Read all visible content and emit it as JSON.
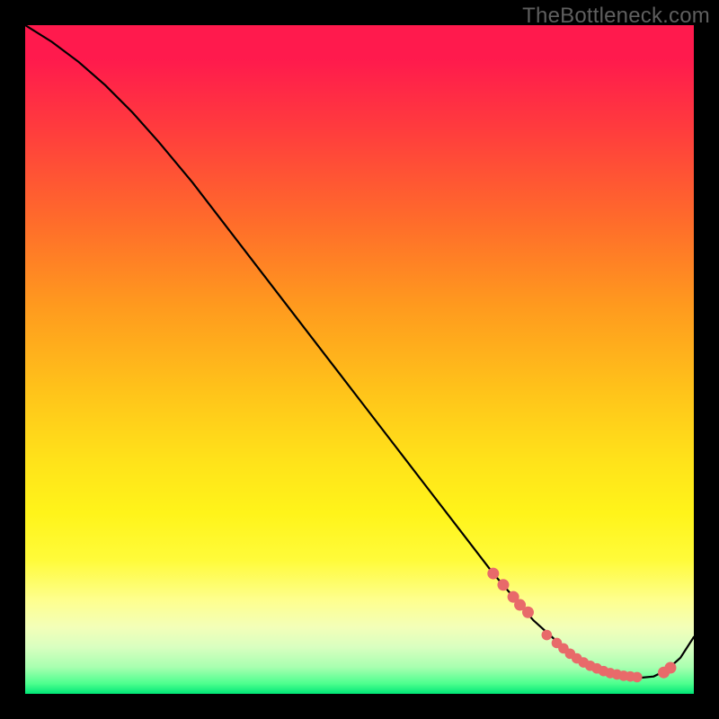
{
  "watermark": "TheBottleneck.com",
  "chart_data": {
    "type": "line",
    "title": "",
    "xlabel": "",
    "ylabel": "",
    "xlim": [
      0,
      100
    ],
    "ylim": [
      0,
      100
    ],
    "grid": false,
    "curve": {
      "x": [
        0,
        4,
        8,
        12,
        16,
        20,
        25,
        30,
        35,
        40,
        45,
        50,
        55,
        60,
        65,
        70,
        73,
        76,
        79,
        82,
        85,
        88,
        90,
        92,
        94,
        96,
        98,
        100
      ],
      "y": [
        100,
        97.5,
        94.5,
        91,
        87,
        82.5,
        76.5,
        70,
        63.5,
        57,
        50.5,
        44,
        37.5,
        31,
        24.5,
        18,
        14.5,
        11,
        8.3,
        6,
        4.2,
        3,
        2.5,
        2.4,
        2.6,
        3.6,
        5.4,
        8.5
      ]
    },
    "cluster_left": {
      "x": [
        70,
        71.5,
        73,
        74,
        75.2
      ],
      "y": [
        18,
        16.3,
        14.5,
        13.3,
        12.2
      ]
    },
    "cluster_bottom": {
      "x": [
        78,
        79.5,
        80.5,
        81.5,
        82.5,
        83.5,
        84.5,
        85.5,
        86.5,
        87.5,
        88.5,
        89.5,
        90.5,
        91.5
      ],
      "y": [
        8.8,
        7.6,
        6.8,
        6.0,
        5.3,
        4.7,
        4.2,
        3.8,
        3.4,
        3.1,
        2.9,
        2.7,
        2.6,
        2.5
      ]
    },
    "cluster_right": {
      "x": [
        95.5,
        96.5
      ],
      "y": [
        3.2,
        3.9
      ]
    },
    "gradient_stops": [
      {
        "pos": 0,
        "color": "#ff1a4d"
      },
      {
        "pos": 0.55,
        "color": "#ffe21a"
      },
      {
        "pos": 0.86,
        "color": "#feff8e"
      },
      {
        "pos": 1.0,
        "color": "#00e676"
      }
    ]
  }
}
